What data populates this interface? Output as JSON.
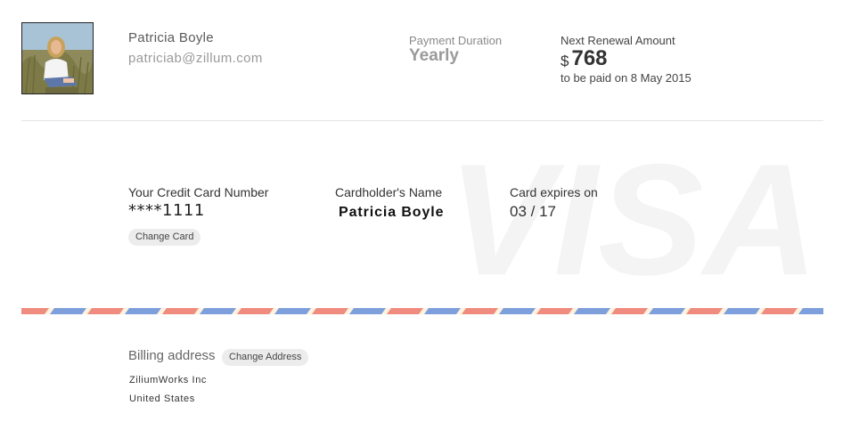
{
  "user": {
    "name": "Patricia Boyle",
    "email": "patriciab@zillum.com"
  },
  "subscription": {
    "duration_label": "Payment Duration",
    "duration_value": "Yearly",
    "renewal_label": "Next Renewal Amount",
    "currency_symbol": "$",
    "renewal_amount": "768",
    "renewal_date_text": "to be paid on 8 May 2015"
  },
  "card": {
    "number_label": "Your Credit Card Number",
    "number_value": "****1111",
    "change_label": "Change Card",
    "holder_label": "Cardholder's Name",
    "holder_value": "Patricia Boyle",
    "expiry_label": "Card expires on",
    "expiry_value": "03 / 17",
    "brand_logo_text": "VISA"
  },
  "billing": {
    "label": "Billing address",
    "change_label": "Change Address",
    "address_lines": [
      "ZiliumWorks Inc",
      "United States"
    ]
  },
  "colors": {
    "airmail_red": "#ef8c7f",
    "airmail_blue": "#7d9fdb",
    "airmail_cream": "#fff3df",
    "visa_watermark": "#f4f4f4",
    "pill_bg": "#ececec"
  }
}
